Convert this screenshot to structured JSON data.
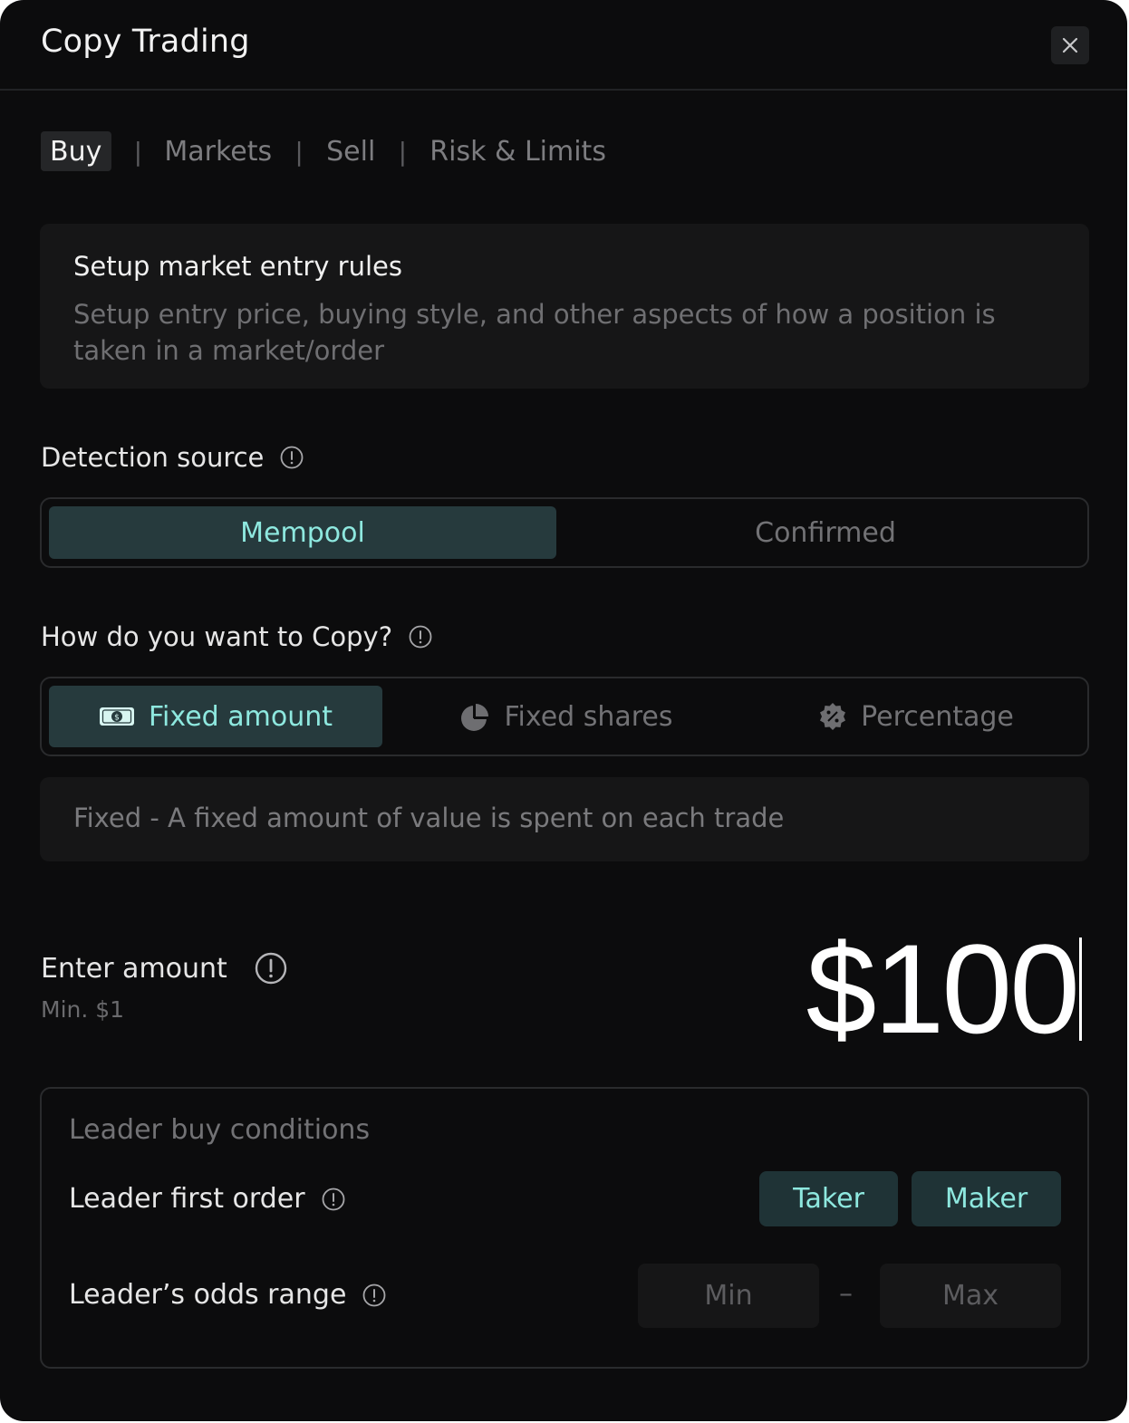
{
  "header": {
    "title": "Copy Trading"
  },
  "tabs": [
    {
      "label": "Buy",
      "active": true
    },
    {
      "label": "Markets",
      "active": false
    },
    {
      "label": "Sell",
      "active": false
    },
    {
      "label": "Risk & Limits",
      "active": false
    }
  ],
  "tab_separator": "|",
  "info_card": {
    "title": "Setup market entry rules",
    "description": "Setup entry price, buying style, and other aspects of how a position is taken in a market/order"
  },
  "detection_source": {
    "label": "Detection source",
    "options": [
      "Mempool",
      "Confirmed"
    ],
    "selected": "Mempool"
  },
  "copy_mode": {
    "label": "How do you want to Copy?",
    "options": [
      {
        "label": "Fixed amount",
        "icon": "cash-icon"
      },
      {
        "label": "Fixed shares",
        "icon": "pie-chart-icon"
      },
      {
        "label": "Percentage",
        "icon": "percent-badge-icon"
      }
    ],
    "selected": "Fixed amount",
    "hint": "Fixed - A fixed amount of value is spent on each trade"
  },
  "amount": {
    "label": "Enter amount",
    "min_text": "Min. $1",
    "value": "$100"
  },
  "conditions": {
    "title": "Leader buy conditions",
    "first_order": {
      "label": "Leader first order",
      "options": [
        "Taker",
        "Maker"
      ]
    },
    "odds_range": {
      "label": "Leader’s odds range",
      "min_placeholder": "Min",
      "max_placeholder": "Max",
      "separator": "–"
    }
  },
  "colors": {
    "background": "#0c0c0d",
    "card": "#161617",
    "accent_text": "#8ee8df",
    "accent_bg": "#263a3d",
    "muted_text": "#727275"
  }
}
